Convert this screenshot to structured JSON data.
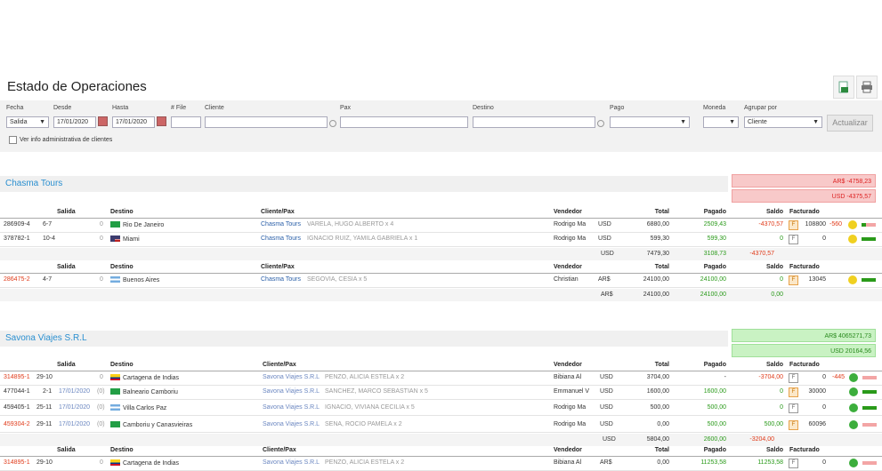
{
  "page": {
    "title": "Estado de Operaciones"
  },
  "filters": {
    "fecha_label": "Fecha",
    "fecha_value": "Salida",
    "desde_label": "Desde",
    "desde_value": "17/01/2020",
    "hasta_label": "Hasta",
    "hasta_value": "17/01/2020",
    "file_label": "# File",
    "cliente_label": "Cliente",
    "pax_label": "Pax",
    "destino_label": "Destino",
    "pago_label": "Pago",
    "moneda_label": "Moneda",
    "agrupar_label": "Agrupar por",
    "agrupar_value": "Cliente",
    "actualizar_label": "Actualizar",
    "admin_info_label": "Ver info administrativa de clientes"
  },
  "columns": {
    "salida": "Salida",
    "destino": "Destino",
    "cliente": "Cliente/Pax",
    "vendedor": "Vendedor",
    "total": "Total",
    "pagado": "Pagado",
    "saldo": "Saldo",
    "facturado": "Facturado"
  },
  "groups": [
    {
      "name": "Chasma Tours",
      "totals": [
        "AR$ -4758,23",
        "USD -4375,57"
      ],
      "rows": [
        {
          "file": "286909-4",
          "salida": "6-7",
          "count": "0",
          "destino": "Rio De Janeiro",
          "cliente": "Chasma Tours",
          "pax": "VARELA, HUGO ALBERTO x 4",
          "vendedor": "Rodrigo Ma",
          "moneda": "USD",
          "total": "6880,00",
          "pagado": "2509,43",
          "saldo": "-4370,57",
          "fact_num": "108800",
          "fact_extra": "-560"
        },
        {
          "file": "378782-1",
          "salida": "10-4",
          "count": "0",
          "destino": "Miami",
          "cliente": "Chasma Tours",
          "pax": "IGNACIO RUIZ, YAMILA GABRIELA x 1",
          "vendedor": "Rodrigo Ma",
          "moneda": "USD",
          "total": "599,30",
          "pagado": "599,30",
          "saldo": "0",
          "fact_num": "0"
        }
      ],
      "sum1": {
        "moneda": "USD",
        "total": "7479,30",
        "pagado": "3108,73",
        "saldo": "-4370,57"
      },
      "rows2": [
        {
          "file": "286475-2",
          "salida": "4-7",
          "count": "0",
          "destino": "Buenos Aires",
          "cliente": "Chasma Tours",
          "pax": "SEGOVIA, CESIA x 5",
          "vendedor": "Christian",
          "moneda": "AR$",
          "total": "24100,00",
          "pagado": "24100,00",
          "saldo": "0",
          "fact_num": "13045"
        }
      ],
      "sum2": {
        "moneda": "AR$",
        "total": "24100,00",
        "pagado": "24100,00",
        "saldo": "0,00"
      }
    },
    {
      "name": "Savona Viajes S.R.L",
      "totals": [
        "AR$ 4065271,73",
        "USD 20164,56"
      ],
      "rows": [
        {
          "file": "314895-1",
          "salida": "29-10",
          "date": "",
          "count": "0",
          "destino": "Cartagena de Indias",
          "cliente": "Savona Viajes S.R.L",
          "pax": "PENZO, ALICIA ESTELA x 2",
          "vendedor": "Bibiana Al",
          "moneda": "USD",
          "total": "3704,00",
          "pagado": "-",
          "saldo": "-3704,00",
          "fact_num": "0",
          "fact_extra": "-445"
        },
        {
          "file": "477044-1",
          "salida": "2-1",
          "date": "17/01/2020",
          "count": "(0)",
          "destino": "Balneario Camboriu",
          "cliente": "Savona Viajes S.R.L",
          "pax": "SANCHEZ, MARCO SEBASTIAN x 5",
          "vendedor": "Emmanuel V",
          "moneda": "USD",
          "total": "1600,00",
          "pagado": "1600,00",
          "saldo": "0",
          "fact_num": "30000"
        },
        {
          "file": "459405-1",
          "salida": "25-11",
          "date": "17/01/2020",
          "count": "(0)",
          "destino": "Villa Carlos Paz",
          "cliente": "Savona Viajes S.R.L",
          "pax": "IGNACIO, VIVIANA CECILIA x 5",
          "vendedor": "Rodrigo Ma",
          "moneda": "USD",
          "total": "500,00",
          "pagado": "500,00",
          "saldo": "0",
          "fact_num": "0"
        },
        {
          "file": "459304-2",
          "salida": "29-11",
          "date": "17/01/2020",
          "count": "(0)",
          "destino": "Camboriu y Canasvieiras",
          "cliente": "Savona Viajes S.R.L",
          "pax": "SENA, ROCIO PAMELA x 2",
          "vendedor": "Rodrigo Ma",
          "moneda": "USD",
          "total": "0,00",
          "pagado": "500,00",
          "saldo": "500,00",
          "fact_num": "60096"
        }
      ],
      "sum1": {
        "moneda": "USD",
        "total": "5804,00",
        "pagado": "2600,00",
        "saldo": "-3204,00"
      },
      "rows2": [
        {
          "file": "314895-1",
          "salida": "29-10",
          "date": "",
          "count": "0",
          "destino": "Cartagena de Indias",
          "cliente": "Savona Viajes S.R.L",
          "pax": "PENZO, ALICIA ESTELA x 2",
          "vendedor": "Bibiana Al",
          "moneda": "AR$",
          "total": "0,00",
          "pagado": "11253,58",
          "saldo": "11253,58",
          "fact_num": "0"
        }
      ]
    }
  ],
  "colors": {
    "accent": "#2a8fd0",
    "negative": "#e03b1a",
    "positive": "#2a9a1a"
  }
}
